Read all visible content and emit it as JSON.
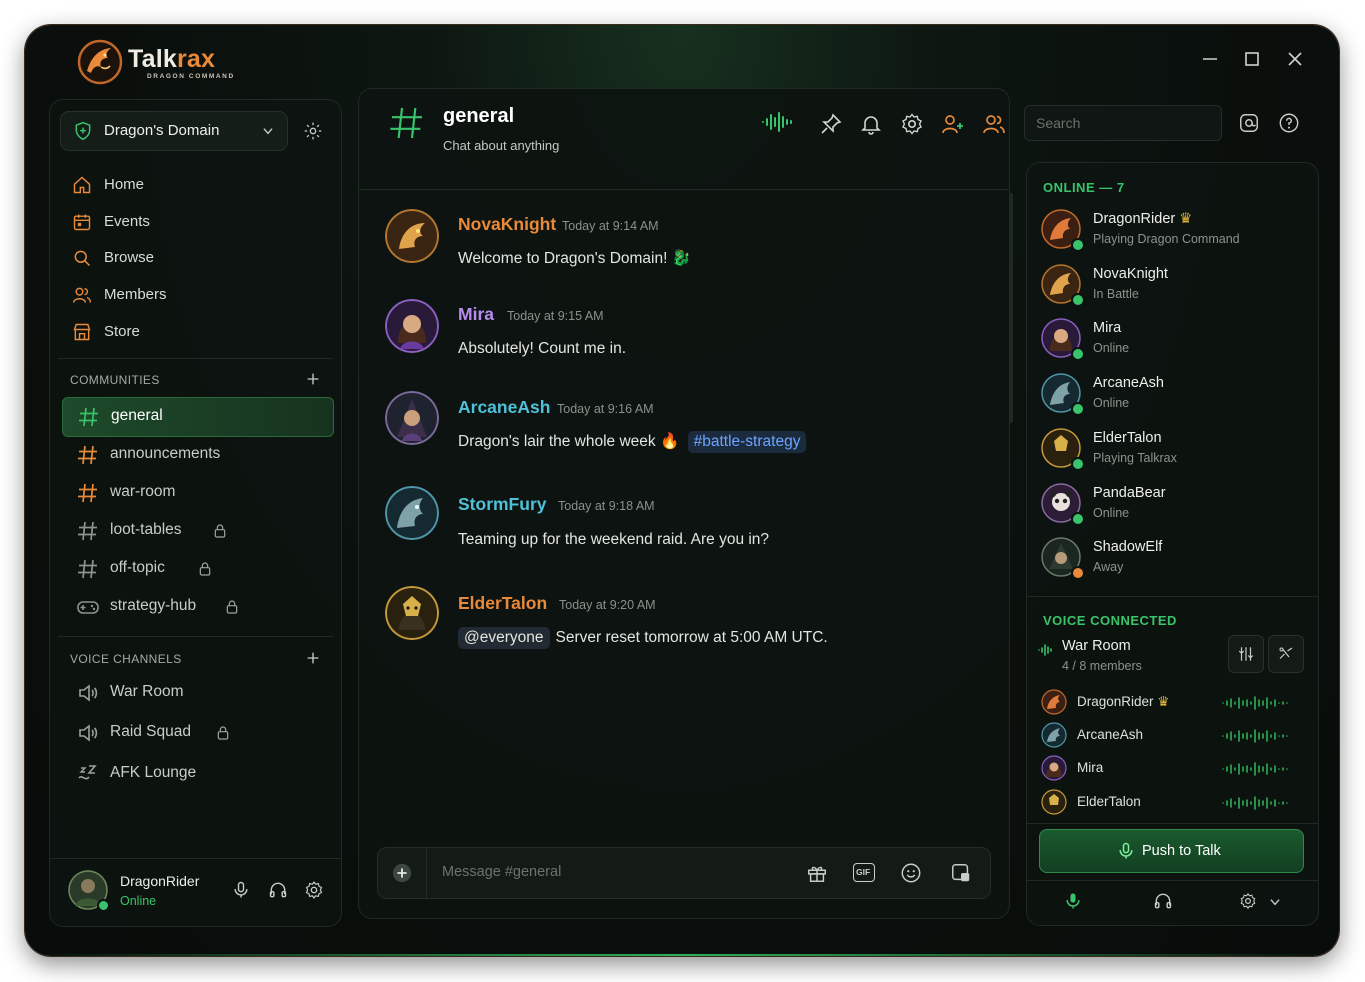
{
  "app": {
    "name_main": "Talk",
    "name_accent": "rax",
    "tagline": "DRAGON COMMAND"
  },
  "colors": {
    "accent_green": "#39c46b",
    "orange": "#e98a3a",
    "purple": "#b78cf0",
    "teal": "#4fc1d9",
    "gold": "#e8b93a"
  },
  "server": {
    "name": "Dragon's Domain"
  },
  "nav": [
    {
      "label": "Home",
      "icon": "home-icon"
    },
    {
      "label": "Events",
      "icon": "calendar-icon"
    },
    {
      "label": "Browse",
      "icon": "search-icon"
    },
    {
      "label": "Members",
      "icon": "members-icon"
    },
    {
      "label": "Store",
      "icon": "store-icon"
    }
  ],
  "communities": {
    "heading": "COMMUNITIES",
    "channels": [
      {
        "label": "general",
        "locked": false,
        "active": true
      },
      {
        "label": "announcements",
        "locked": false
      },
      {
        "label": "war-room",
        "locked": false
      },
      {
        "label": "loot-tables",
        "locked": true
      },
      {
        "label": "off-topic",
        "locked": true
      },
      {
        "label": "strategy-hub",
        "locked": true
      }
    ]
  },
  "voice_channels": {
    "heading": "VOICE CHANNELS",
    "channels": [
      {
        "label": "War Room",
        "locked": false
      },
      {
        "label": "Raid Squad",
        "locked": true
      },
      {
        "label": "AFK Lounge",
        "locked": false
      }
    ]
  },
  "user": {
    "name": "DragonRider",
    "status": "Online"
  },
  "channel": {
    "name": "general",
    "topic": "Chat about anything"
  },
  "search": {
    "placeholder": "Search"
  },
  "messages": [
    {
      "author": "NovaKnight",
      "time": "Today at 9:14 AM",
      "text": "Welcome to Dragon's Domain!",
      "emoji": "🐉",
      "color": "#e98a3a"
    },
    {
      "author": "Mira",
      "time": "Today at 9:15 AM",
      "text": "Absolutely! Count me in.",
      "color": "#b78cf0"
    },
    {
      "author": "ArcaneAsh",
      "time": "Today at 9:16 AM",
      "text": "Dragon's lair the whole week",
      "emoji": "🔥",
      "tag": "#battle-strategy",
      "color": "#4fc1d9"
    },
    {
      "author": "StormFury",
      "time": "Today at 9:18 AM",
      "text": "Teaming up for the weekend raid. Are you in?",
      "color": "#4fc1d9"
    },
    {
      "author": "ElderTalon",
      "time": "Today at 9:20 AM",
      "mention": "@everyone",
      "text": "Server reset tomorrow at 5:00 AM UTC.",
      "color": "#e98a3a"
    }
  ],
  "composer": {
    "placeholder": "Message #general",
    "gif_label": "GIF"
  },
  "online": {
    "heading": "ONLINE — 7",
    "members": [
      {
        "name": "DragonRider",
        "status": "Playing Dragon Command",
        "crown": true,
        "presence": "#39c46b"
      },
      {
        "name": "NovaKnight",
        "status": "In Battle",
        "presence": "#39c46b"
      },
      {
        "name": "Mira",
        "status": "Online",
        "presence": "#39c46b"
      },
      {
        "name": "ArcaneAsh",
        "status": "Online",
        "presence": "#39c46b"
      },
      {
        "name": "ElderTalon",
        "status": "Playing Talkrax",
        "presence": "#39c46b"
      },
      {
        "name": "PandaBear",
        "status": "Online",
        "presence": "#39c46b"
      },
      {
        "name": "ShadowElf",
        "status": "Away",
        "presence": "#e98a3a"
      }
    ]
  },
  "voice": {
    "heading": "VOICE CONNECTED",
    "room": "War Room",
    "count": "4 / 8 members",
    "members": [
      {
        "name": "DragonRider",
        "crown": true
      },
      {
        "name": "ArcaneAsh"
      },
      {
        "name": "Mira"
      },
      {
        "name": "ElderTalon"
      }
    ],
    "ptt_label": "Push to Talk"
  }
}
